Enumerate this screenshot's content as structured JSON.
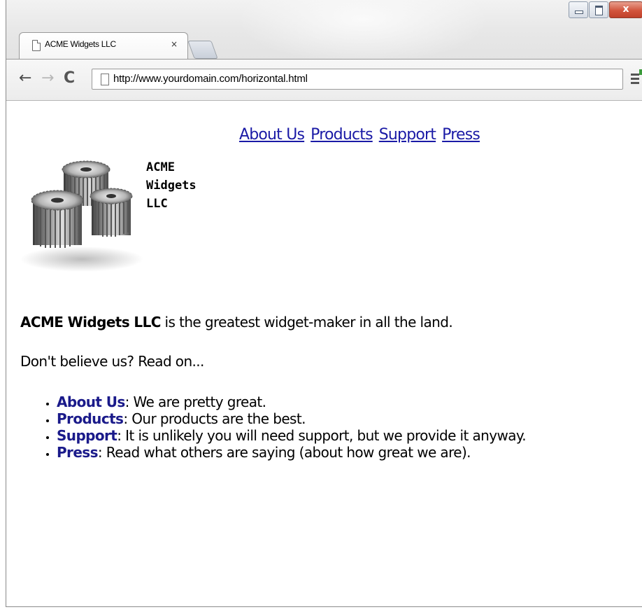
{
  "window": {
    "minimize_label": "",
    "maximize_label": "",
    "close_label": "x",
    "close_color": "#d2553d"
  },
  "tab": {
    "title": "ACME Widgets LLC",
    "close_glyph": "×"
  },
  "toolbar": {
    "back_glyph": "←",
    "forward_glyph": "→",
    "reload_glyph": "C",
    "url": "http://www.yourdomain.com/horizontal.html",
    "menu_glyph": "≡"
  },
  "page": {
    "nav": [
      "About Us",
      "Products",
      "Support",
      "Press"
    ],
    "link_color": "#1a1aa6",
    "company": [
      "ACME",
      "Widgets",
      "LLC"
    ],
    "logo_icon": "gears-logo",
    "intro_bold": "ACME Widgets LLC",
    "intro_rest": " is the greatest widget-maker in all the land.",
    "lead": "Don't believe us? Read on...",
    "bullets": [
      {
        "name": "About Us",
        "text": ": We are pretty great."
      },
      {
        "name": "Products",
        "text": ": Our products are the best."
      },
      {
        "name": "Support",
        "text": ": It is unlikely you will need support, but we provide it anyway."
      },
      {
        "name": "Press",
        "text": ": Read what others are saying (about how great we are)."
      }
    ]
  }
}
